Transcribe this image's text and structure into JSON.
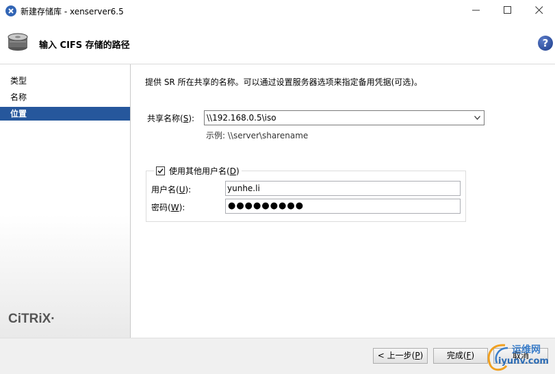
{
  "window": {
    "title": "新建存储库 - xenserver6.5"
  },
  "header": {
    "title": "输入 CIFS 存储的路径",
    "help_symbol": "?"
  },
  "nav": {
    "items": [
      {
        "label": "类型",
        "active": false
      },
      {
        "label": "名称",
        "active": false
      },
      {
        "label": "位置",
        "active": true
      }
    ],
    "logo_text": "CiTRiX·"
  },
  "content": {
    "description": "提供 SR 所在共享的名称。可以通过设置服务器选项来指定备用凭据(可选)。",
    "share_label_pre": "共享名称(",
    "share_label_key": "S",
    "share_label_post": "):",
    "share_value": "\\\\192.168.0.5\\iso",
    "example": "示例: \\\\server\\sharename",
    "use_other_user_pre": "使用其他用户名(",
    "use_other_user_key": "D",
    "use_other_user_post": ")",
    "use_other_user_checked": true,
    "username_label_pre": "用户名(",
    "username_label_key": "U",
    "username_label_post": "):",
    "username_value": "yunhe.li",
    "password_label_pre": "密码(",
    "password_label_key": "W",
    "password_label_post": "):",
    "password_mask": "●●●●●●●●●"
  },
  "footer": {
    "back_pre": "< 上一步(",
    "back_key": "P",
    "back_post": ")",
    "finish_pre": "完成(",
    "finish_key": "F",
    "finish_post": ")",
    "cancel_label": "取消"
  },
  "watermark": {
    "top": "运维网",
    "bottom": "iyunv.com"
  },
  "colors": {
    "accent": "#26579c",
    "app_icon": "#3265b5"
  }
}
